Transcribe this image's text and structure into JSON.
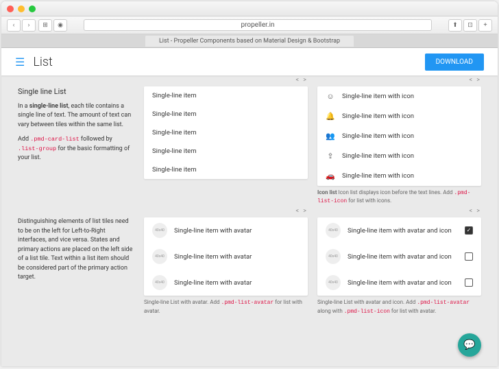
{
  "browser": {
    "url": "propeller.in",
    "tab_title": "List - Propeller Components based on Material Design & Bootstrap"
  },
  "header": {
    "title": "List",
    "download": "DOWNLOAD"
  },
  "section1": {
    "title": "Single line List",
    "desc_pre": "In a ",
    "desc_bold": "single-line list",
    "desc_post": ", each tile contains a single line of text. The amount of text can vary between tiles within the same list.",
    "desc2_pre": "Add ",
    "code1": ".pmd-card-list",
    "desc2_mid": " followed by ",
    "code2": ".list-group",
    "desc2_post": " for the basic formatting of your list.",
    "plain_items": [
      "Single-line item",
      "Single-line item",
      "Single-line item",
      "Single-line item",
      "Single-line item"
    ],
    "icon_items": [
      {
        "icon": "☺",
        "label": "Single-line item with icon"
      },
      {
        "icon": "🔔",
        "label": "Single-line item with icon"
      },
      {
        "icon": "👥",
        "label": "Single-line item with icon"
      },
      {
        "icon": "⇪",
        "label": "Single-line item with icon"
      },
      {
        "icon": "🚗",
        "label": "Single-line item with icon"
      }
    ],
    "icon_caption_pre": "Icon list displays icon before the text lines. Add ",
    "icon_caption_code": ".pmd-list-icon",
    "icon_caption_post": " for list with icons."
  },
  "section2": {
    "desc": "Distinguishing elements of list tiles need to be on the left for Left-to-Right interfaces, and vice versa. States and primary actions are placed on the left side of a list tile. Text within a list item should be considered part of the primary action target.",
    "avatar_items": [
      "Single-line item with avatar",
      "Single-line item with avatar",
      "Single-line item with avatar"
    ],
    "avatar_caption_pre": "Single-line List with avatar. Add ",
    "avatar_caption_code": ".pmd-list-avatar",
    "avatar_caption_post": " for list with avatar.",
    "avatar_icon_items": [
      {
        "label": "Single-line item with avatar and icon",
        "checked": true
      },
      {
        "label": "Single-line item with avatar and icon",
        "checked": false
      },
      {
        "label": "Single-line item with avatar and icon",
        "checked": false
      }
    ],
    "ai_caption_pre": "Single-line List with avatar and icon. Add ",
    "ai_caption_code1": ".pmd-list-avatar",
    "ai_caption_mid": " along with ",
    "ai_caption_code2": ".pmd-list-icon",
    "ai_caption_post": " for list with avatar.",
    "av_placeholder": "40x40"
  }
}
